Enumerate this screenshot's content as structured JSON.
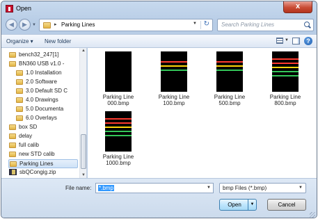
{
  "window": {
    "title": "Open",
    "close_label": "x"
  },
  "navigation": {
    "back_glyph": "◀",
    "forward_glyph": "▶",
    "breadcrumb_separator": "▸",
    "breadcrumb": "Parking Lines",
    "search_placeholder": "Search Parking Lines"
  },
  "toolbar": {
    "organize": "Organize ▾",
    "new_folder": "New folder",
    "help": "?"
  },
  "tree": [
    {
      "label": "bench32_247[1]",
      "indent": 1
    },
    {
      "label": "BN360 USB v1.0 -",
      "indent": 1
    },
    {
      "label": "1.0 Installation",
      "indent": 2
    },
    {
      "label": "2.0 Software",
      "indent": 2
    },
    {
      "label": "3.0 Default SD C",
      "indent": 2
    },
    {
      "label": "4.0 Drawings",
      "indent": 2
    },
    {
      "label": "5.0 Documenta",
      "indent": 2
    },
    {
      "label": "6.0 Overlays",
      "indent": 2
    },
    {
      "label": "box SD",
      "indent": 1
    },
    {
      "label": "delay",
      "indent": 1
    },
    {
      "label": "full calib",
      "indent": 1
    },
    {
      "label": "new STD calib",
      "indent": 1
    },
    {
      "label": "Parking Lines",
      "indent": 1,
      "selected": true
    },
    {
      "label": "sbQCongig.zip",
      "indent": 1,
      "zip": true
    }
  ],
  "files": [
    {
      "line1": "Parking Line",
      "line2": "000.bmp",
      "bars": []
    },
    {
      "line1": "Parking Line",
      "line2": "100.bmp",
      "bars": [
        "#ff3b30",
        "#ffd60a",
        "#34c759"
      ]
    },
    {
      "line1": "Parking Line",
      "line2": "500.bmp",
      "bars": [
        "#ff3b30",
        "#ffd60a",
        "#34c759"
      ]
    },
    {
      "line1": "Parking Line",
      "line2": "800.bmp",
      "bars": [
        "#ff3b30",
        "#ff3b30",
        "#ffd60a",
        "#34c759",
        "#34c759"
      ]
    },
    {
      "line1": "Parking Line",
      "line2": "1000.bmp",
      "bars": [
        "#ff3b30",
        "#ff3b30",
        "#ffd60a",
        "#34c759",
        "#34c759"
      ]
    }
  ],
  "footer": {
    "file_name_label": "File name:",
    "file_name_value": "*.bmp",
    "file_type": "bmp Files (*.bmp)",
    "open_label": "Open",
    "cancel_label": "Cancel"
  }
}
